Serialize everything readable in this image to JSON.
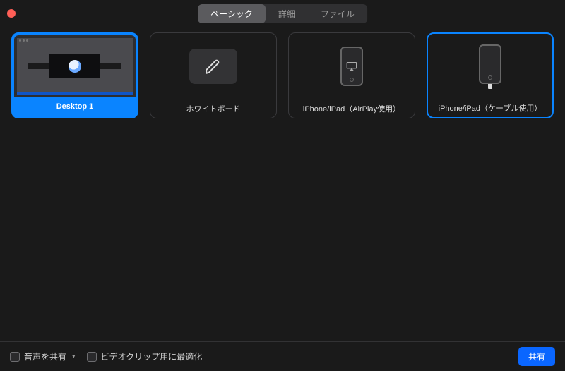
{
  "tabs": {
    "basic": "ベーシック",
    "advanced": "詳細",
    "files": "ファイル"
  },
  "tiles": {
    "desktop1": {
      "label": "Desktop 1"
    },
    "whiteboard": {
      "label": "ホワイトボード"
    },
    "airplay": {
      "label": "iPhone/iPad（AirPlay使用）"
    },
    "cable": {
      "label": "iPhone/iPad（ケーブル使用）"
    }
  },
  "footer": {
    "shareAudio": "音声を共有",
    "optimizeVideo": "ビデオクリップ用に最適化",
    "shareButton": "共有"
  },
  "colors": {
    "accent": "#0a84ff",
    "shareBtn": "#0a66ff"
  }
}
